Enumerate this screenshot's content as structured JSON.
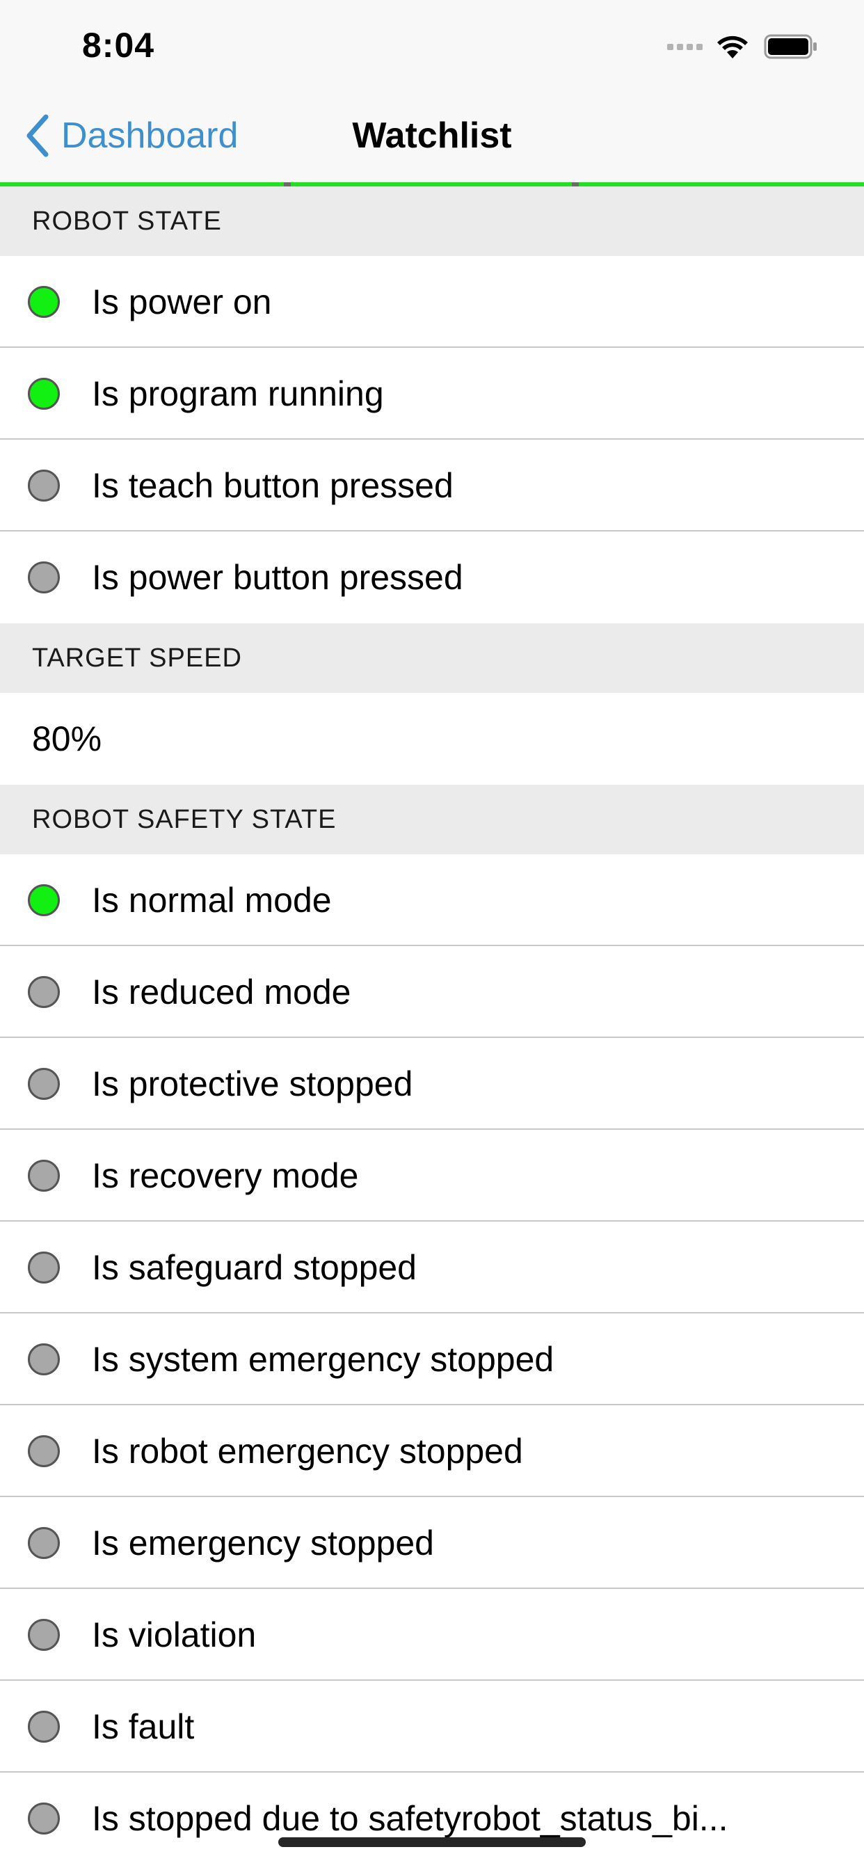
{
  "status_bar": {
    "time": "8:04"
  },
  "nav": {
    "back_label": "Dashboard",
    "title": "Watchlist",
    "accent_color": "#3d8fce",
    "underline_color": "#22e01f"
  },
  "colors": {
    "indicator_on": "#12f012",
    "indicator_off": "#a8a8a8"
  },
  "sections": [
    {
      "title": "ROBOT STATE",
      "items": [
        {
          "label": "Is power on",
          "active": true
        },
        {
          "label": "Is program running",
          "active": true
        },
        {
          "label": "Is teach button pressed",
          "active": false
        },
        {
          "label": "Is power button pressed",
          "active": false
        }
      ]
    },
    {
      "title": "TARGET SPEED",
      "value": "80%"
    },
    {
      "title": "ROBOT SAFETY STATE",
      "items": [
        {
          "label": "Is normal mode",
          "active": true
        },
        {
          "label": "Is reduced mode",
          "active": false
        },
        {
          "label": "Is protective stopped",
          "active": false
        },
        {
          "label": "Is recovery mode",
          "active": false
        },
        {
          "label": "Is safeguard stopped",
          "active": false
        },
        {
          "label": "Is system emergency stopped",
          "active": false
        },
        {
          "label": "Is robot emergency stopped",
          "active": false
        },
        {
          "label": "Is emergency stopped",
          "active": false
        },
        {
          "label": "Is violation",
          "active": false
        },
        {
          "label": "Is fault",
          "active": false
        },
        {
          "label": "Is stopped due to safetyrobot_status_bi...",
          "active": false
        }
      ]
    }
  ]
}
